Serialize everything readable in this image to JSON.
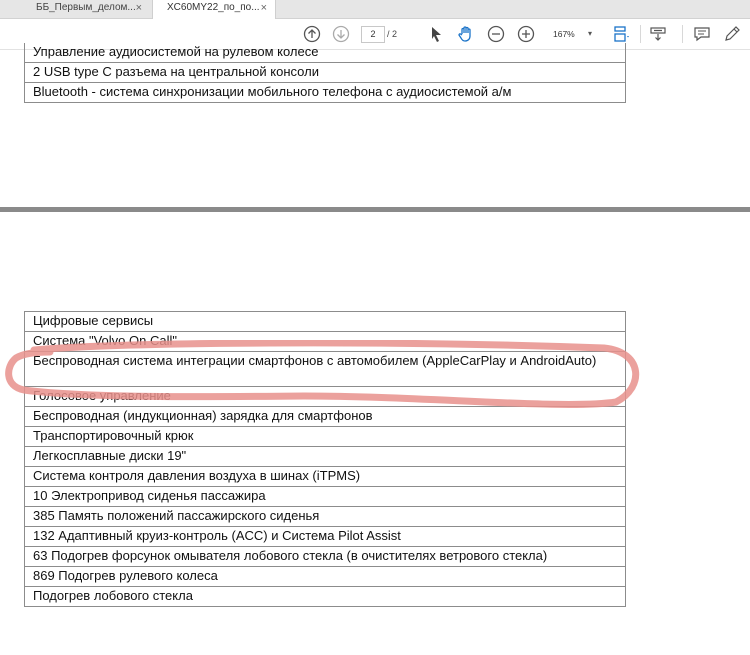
{
  "tabs": [
    {
      "label": "ББ_Первым_делом...",
      "close": "×"
    },
    {
      "label": "XC60MY22_по_по...",
      "close": "×"
    }
  ],
  "toolbar": {
    "page_current": "2",
    "page_total": "/ 2",
    "zoom": "167%",
    "icons": [
      "prev-page-icon",
      "next-page-icon",
      "select-cursor-icon",
      "hand-tool-icon",
      "zoom-out-icon",
      "zoom-in-icon",
      "fit-page-icon",
      "scroll-mode-icon",
      "comment-icon",
      "pen-icon"
    ]
  },
  "page1_rows": [
    "Управление аудиосистемой на рулевом колесе",
    "2 USB type C разъема на центральной консоли",
    "Bluetooth - система синхронизации мобильного телефона с аудиосистемой а/м"
  ],
  "page2_rows": [
    "Цифровые сервисы",
    "Система \"Volvo On Call\"",
    "Беспроводная система интеграции смартфонов с автомобилем (AppleCarPlay и AndroidAuto)",
    "Голосовое управление",
    "Беспроводная (индукционная) зарядка для смартфонов",
    "Транспортировочный крюк",
    "Легкосплавные диски 19\"",
    "Система контроля давления воздуха в шинах (iTPMS)",
    "10 Электропривод сиденья пассажира",
    "385 Память положений пассажирского сиденья",
    "132 Адаптивный круиз-контроль (ACC) и Система Pilot Assist",
    "63 Подогрев форсунок омывателя лобового стекла (в очистителях ветрового стекла)",
    "869 Подогрев рулевого колеса",
    "Подогрев лобового стекла"
  ],
  "colors": {
    "highlight": "#e8908c",
    "divider": "#8a8a8a"
  }
}
